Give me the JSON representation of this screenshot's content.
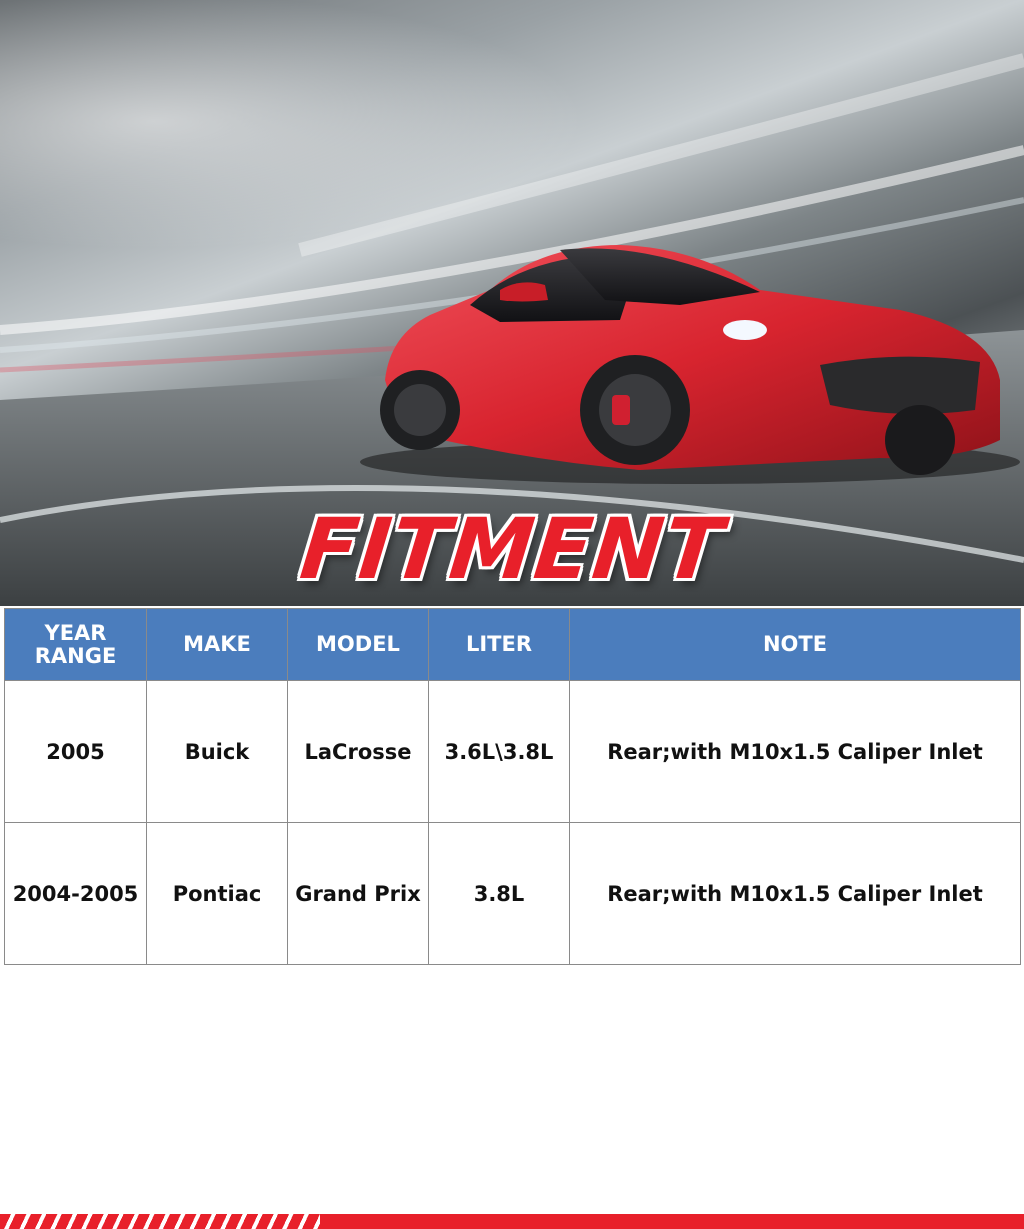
{
  "hero": {
    "title": "FITMENT"
  },
  "table": {
    "headers": [
      "YEAR\nRANGE",
      "MAKE",
      "MODEL",
      "LITER",
      "NOTE"
    ],
    "rows": [
      [
        "2005",
        "Buick",
        "LaCrosse",
        "3.6L\\3.8L",
        "Rear;with M10x1.5 Caliper Inlet"
      ],
      [
        "2004-2005",
        "Pontiac",
        "Grand Prix",
        "3.8L",
        "Rear;with M10x1.5 Caliper Inlet"
      ]
    ]
  },
  "colors": {
    "header_blue": "#4b7dbd",
    "accent_red": "#e8202a",
    "car_red": "#d8242f"
  }
}
